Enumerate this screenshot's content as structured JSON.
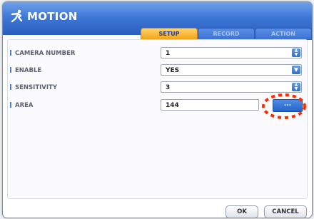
{
  "window": {
    "title": "MOTION",
    "title_icon": "running-person-icon"
  },
  "tabs": [
    {
      "label": "SETUP",
      "active": true
    },
    {
      "label": "RECORD",
      "active": false
    },
    {
      "label": "ACTION",
      "active": false
    }
  ],
  "settings": {
    "camera_number": {
      "label": "CAMERA NUMBER",
      "value": "1",
      "control": "spinner"
    },
    "enable": {
      "label": "ENABLE",
      "value": "YES",
      "control": "dropdown"
    },
    "sensitivity": {
      "label": "SENSITIVITY",
      "value": "3",
      "control": "spinner"
    },
    "area": {
      "label": "AREA",
      "value": "144",
      "button_label": "..."
    }
  },
  "footer": {
    "ok_label": "OK",
    "cancel_label": "CANCEL"
  },
  "colors": {
    "titlebar": "#3f78d6",
    "active_tab": "#f3a21b",
    "highlight": "#ff2a00"
  }
}
